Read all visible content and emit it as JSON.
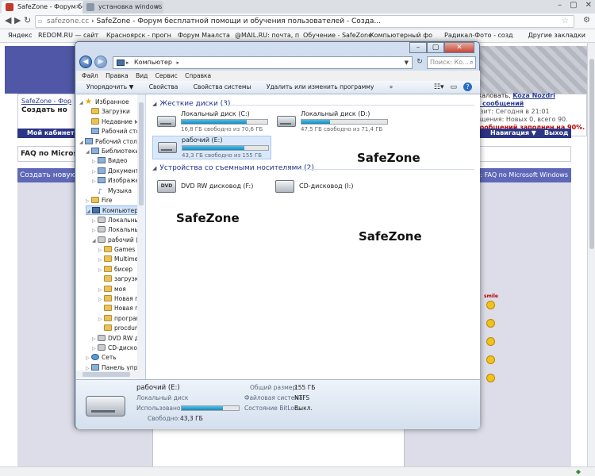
{
  "browser": {
    "tabs": [
      {
        "label": "SafeZone - Форум бе",
        "favicon_color": "#c0392b"
      },
      {
        "label": "установка windows -",
        "favicon_color": "#8a96a8"
      }
    ],
    "url_host": "safezone.cc",
    "url_rest": " › SafeZone - Форум бесплатной помощи и обучения пользователей - Созда...",
    "bookmarks": [
      "Яндекс",
      "REDOM.RU — сайт",
      "Красноярск - прогн",
      "Форум Маалста",
      "@MAIL.RU: почта, п",
      "Обучение - SafeZone",
      "Компьютерный фо",
      "Радикал-Фото - созд"
    ],
    "bookmarks_other": "Другие закладки"
  },
  "forum": {
    "breadcrumb": "SafeZone - Фор",
    "title_partial": "Создать но",
    "userinfo_line1_prefix": "жаловать,",
    "userinfo_user": "Koza Nozdri",
    "userinfo_line2": "х сообщений",
    "userinfo_line3": "изит: Сегодня в 21:01",
    "userinfo_line4": "бщения: Новых 0, всего 90.",
    "userinfo_line5": "сообщений заполнен на 90%.",
    "navbar_left": "Мой кабинет",
    "navbar_nav": "Навигация ▼",
    "navbar_exit": "Выход",
    "faq": "FAQ по Microsof",
    "create_bar": "Создать новую",
    "create_bar_right": "дел: FAQ по Microsoft Windows",
    "smiley_label": "smile"
  },
  "explorer": {
    "address": "Компьютер",
    "search_placeholder": "Поиск: Ко...",
    "menu": [
      "Файл",
      "Правка",
      "Вид",
      "Сервис",
      "Справка"
    ],
    "toolbar": [
      "Упорядочить ▼",
      "Свойства",
      "Свойства системы",
      "Удалить или изменить программу",
      "»"
    ],
    "nav": [
      {
        "label": "Избранное",
        "icon": "star",
        "indent": 0,
        "tri": "◢"
      },
      {
        "label": "Загрузки",
        "icon": "folder",
        "indent": 1,
        "tri": ""
      },
      {
        "label": "Недавние места",
        "icon": "folder",
        "indent": 1,
        "tri": ""
      },
      {
        "label": "Рабочий стол",
        "icon": "lib",
        "indent": 1,
        "tri": ""
      },
      {
        "label": "Рабочий стол",
        "icon": "lib",
        "indent": 0,
        "tri": "◢"
      },
      {
        "label": "Библиотеки",
        "icon": "lib",
        "indent": 1,
        "tri": "◢"
      },
      {
        "label": "Видео",
        "icon": "lib",
        "indent": 2,
        "tri": "▷"
      },
      {
        "label": "Документы",
        "icon": "lib",
        "indent": 2,
        "tri": "▷"
      },
      {
        "label": "Изображения",
        "icon": "lib",
        "indent": 2,
        "tri": "▷"
      },
      {
        "label": "Музыка",
        "icon": "music",
        "indent": 2,
        "tri": ""
      },
      {
        "label": "Fire",
        "icon": "folder",
        "indent": 1,
        "tri": "▷"
      },
      {
        "label": "Компьютер",
        "icon": "pc",
        "indent": 1,
        "tri": "◢",
        "selected": true
      },
      {
        "label": "Локальный диск",
        "icon": "drive",
        "indent": 2,
        "tri": "▷"
      },
      {
        "label": "Локальный диск",
        "icon": "drive",
        "indent": 2,
        "tri": "▷"
      },
      {
        "label": "рабочий (E:)",
        "icon": "drive",
        "indent": 2,
        "tri": "◢"
      },
      {
        "label": "Games",
        "icon": "folder",
        "indent": 3,
        "tri": "▷"
      },
      {
        "label": "Multimedia",
        "icon": "folder",
        "indent": 3,
        "tri": "▷"
      },
      {
        "label": "бисер",
        "icon": "folder",
        "indent": 3,
        "tri": "▷"
      },
      {
        "label": "загрузки",
        "icon": "folder",
        "indent": 3,
        "tri": ""
      },
      {
        "label": "моя",
        "icon": "folder",
        "indent": 3,
        "tri": "▷"
      },
      {
        "label": "Новая папка",
        "icon": "folder",
        "indent": 3,
        "tri": "▷"
      },
      {
        "label": "Новая папка",
        "icon": "folder",
        "indent": 3,
        "tri": ""
      },
      {
        "label": "программы",
        "icon": "folder",
        "indent": 3,
        "tri": "▷"
      },
      {
        "label": "procdump",
        "icon": "folder",
        "indent": 3,
        "tri": ""
      },
      {
        "label": "DVD RW дисково",
        "icon": "drive",
        "indent": 2,
        "tri": "▷"
      },
      {
        "label": "CD-дисковод",
        "icon": "drive",
        "indent": 2,
        "tri": "▷"
      },
      {
        "label": "Сеть",
        "icon": "net",
        "indent": 1,
        "tri": "▷"
      },
      {
        "label": "Панель управле",
        "icon": "lib",
        "indent": 1,
        "tri": "▷"
      }
    ],
    "group_hdd": "Жесткие диски (3)",
    "group_removable": "Устройства со съемными носителями (2)",
    "drives": [
      {
        "name": "Локальный диск (C:)",
        "free": "16,8 ГБ свободно из 70,6 ГБ",
        "used_fraction": 0.76,
        "selected": false
      },
      {
        "name": "Локальный диск (D:)",
        "free": "47,5 ГБ свободно из 71,4 ГБ",
        "used_fraction": 0.33,
        "selected": false
      },
      {
        "name": "рабочий (E:)",
        "free": "43,3 ГБ свободно из 155 ГБ",
        "used_fraction": 0.72,
        "selected": true
      }
    ],
    "removable": [
      {
        "name": "DVD RW дисковод (F:)",
        "icon_text": "DVD"
      },
      {
        "name": "CD-дисковод (I:)",
        "icon_text": ""
      }
    ],
    "details": {
      "name": "рабочий (E:)",
      "type": "Локальный диск",
      "used_label": "Использовано:",
      "free_label": "Свободно:",
      "free_value": "43,3 ГБ",
      "used_fraction": 0.72,
      "total_label": "Общий размер:",
      "total_value": "155 ГБ",
      "fs_label": "Файловая система:",
      "fs_value": "NTFS",
      "bitlocker_label": "Состояние BitLoc...",
      "bitlocker_value": "Выкл."
    }
  },
  "watermarks": [
    "SafeZone",
    "SafeZone",
    "SafeZone"
  ]
}
